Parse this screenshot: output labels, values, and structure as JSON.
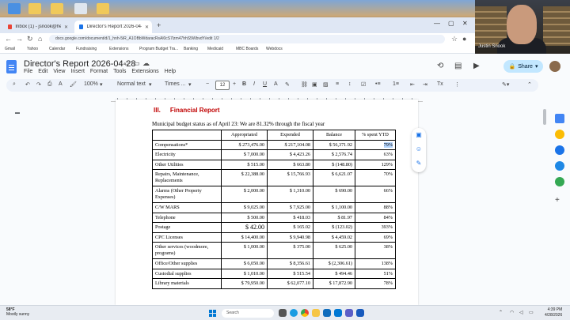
{
  "browser": {
    "tabs": [
      {
        "label": "Inbox (1) - jsnook@hemlocklibrary.org"
      },
      {
        "label": "Director's Report 2026-04-28 - G..."
      }
    ],
    "url": "docs.google.com/document/d/1_hnh-5iR_A1OBbWdaracRsAl0cS7lzm47hhS5WbvdY/edit  1/2",
    "bookmarks": [
      "Gmail",
      "Yahoo",
      "Calendar",
      "Fundraising",
      "Extensions",
      "Program Budget Tra...",
      "Banking",
      "Medicaid",
      "MBC Boards",
      "Webdocs"
    ]
  },
  "docs": {
    "title": "Director's Report 2026-04-28",
    "menu": [
      "File",
      "Edit",
      "View",
      "Insert",
      "Format",
      "Tools",
      "Extensions",
      "Help"
    ],
    "share_label": "Share",
    "toolbar": {
      "zoom": "100%",
      "style": "Normal text",
      "font": "Times ...",
      "font_size": "12"
    }
  },
  "document": {
    "section_number": "III.",
    "section_title": "Financial Report",
    "budget_status": "Municipal budget status as of April 23: We are 81.32% through the fiscal year",
    "table": {
      "headers": [
        "",
        "Appropriated",
        "Expended",
        "Balance",
        "% spent YTD"
      ],
      "rows": [
        [
          "Compensations*",
          "$ 273,476.00",
          "$ 217,104.08",
          "$ 56,371.92",
          "79%"
        ],
        [
          "Electricity",
          "$ 7,000.00",
          "$ 4,423.26",
          "$ 2,576.74",
          "63%"
        ],
        [
          "Other Utilities",
          "$ 515.00",
          "$ 663.80",
          "$ (148.80)",
          "129%"
        ],
        [
          "Repairs, Maintenance, Replacements",
          "$ 22,388.00",
          "$ 15,766.93",
          "$ 6,621.07",
          "70%"
        ],
        [
          "Alarms (Other Property Expenses)",
          "$ 2,000.00",
          "$ 1,310.00",
          "$ 690.00",
          "66%"
        ],
        [
          "C/W MARS",
          "$ 9,025.00",
          "$ 7,925.00",
          "$ 1,100.00",
          "88%"
        ],
        [
          "Telephone",
          "$ 500.00",
          "$ 418.03",
          "$ 81.97",
          "84%"
        ],
        [
          "Postage",
          "$ 42.00",
          "$ 165.02",
          "$ (123.02)",
          "393%"
        ],
        [
          "CPC Licenses",
          "$ 14,400.00",
          "$ 9,940.98",
          "$ 4,459.02",
          "69%"
        ],
        [
          "Other services (woodmore, programs)",
          "$ 1,000.00",
          "$ 375.00",
          "$ 625.00",
          "38%"
        ],
        [
          "Office/Other supplies",
          "$ 6,050.00",
          "$ 8,356.61",
          "$ (2,306.61)",
          "138%"
        ],
        [
          "Custodial supplies",
          "$ 1,010.00",
          "$ 515.54",
          "$ 494.46",
          "51%"
        ],
        [
          "Library materials",
          "$ 79,950.00",
          "$ 62,077.10",
          "$ 17,872.90",
          "78%"
        ]
      ]
    }
  },
  "webcam": {
    "name": "Justin Snook"
  },
  "taskbar": {
    "weather_temp": "58°F",
    "weather_desc": "Mostly sunny",
    "search_placeholder": "Search",
    "time": "4:39 PM",
    "date": "4/28/2026"
  }
}
